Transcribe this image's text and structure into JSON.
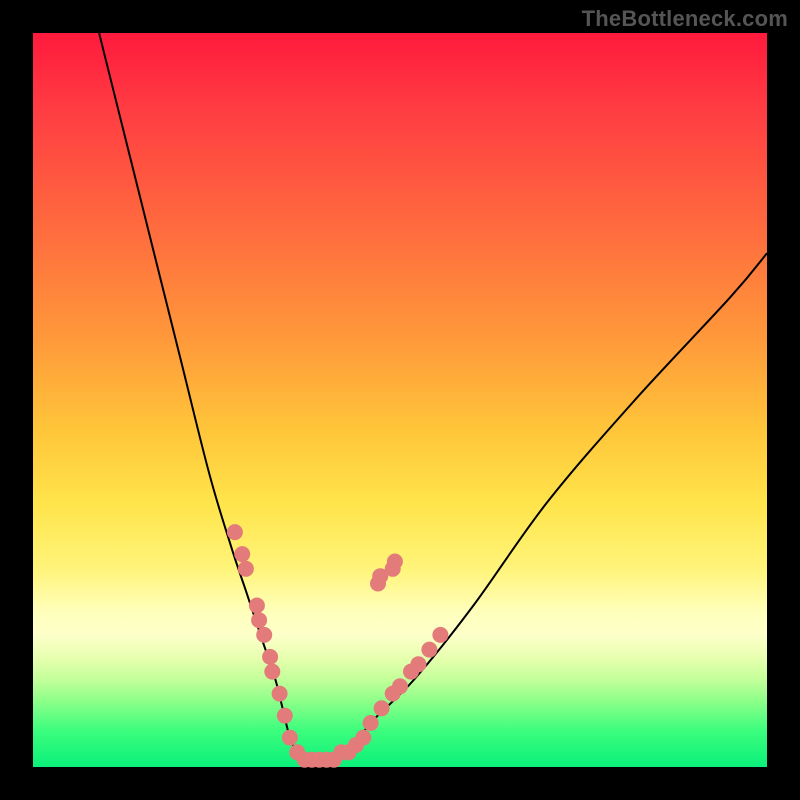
{
  "watermark": "TheBottleneck.com",
  "colors": {
    "background": "#000000",
    "curve": "#000000",
    "marker": "#e47b7b",
    "gradient_top": "#ff1a3d",
    "gradient_bottom": "#0af07a"
  },
  "chart_data": {
    "type": "line",
    "title": "",
    "xlabel": "",
    "ylabel": "",
    "xlim": [
      0,
      100
    ],
    "ylim": [
      0,
      100
    ],
    "series": [
      {
        "name": "bottleneck-curve",
        "x": [
          9,
          12,
          16,
          20,
          24,
          27,
          29,
          31,
          33,
          34,
          35,
          36,
          37,
          38,
          40,
          43,
          46,
          52,
          60,
          70,
          82,
          95,
          100
        ],
        "y": [
          100,
          88,
          72,
          56,
          40,
          30,
          24,
          18,
          12,
          8,
          4,
          2,
          1,
          1,
          1,
          2,
          6,
          12,
          22,
          36,
          50,
          64,
          70
        ]
      }
    ],
    "markers": [
      {
        "x": 27.5,
        "y": 32
      },
      {
        "x": 28.5,
        "y": 29
      },
      {
        "x": 29.0,
        "y": 27
      },
      {
        "x": 30.5,
        "y": 22
      },
      {
        "x": 30.8,
        "y": 20
      },
      {
        "x": 31.5,
        "y": 18
      },
      {
        "x": 32.3,
        "y": 15
      },
      {
        "x": 32.6,
        "y": 13
      },
      {
        "x": 33.6,
        "y": 10
      },
      {
        "x": 34.3,
        "y": 7
      },
      {
        "x": 35.0,
        "y": 4
      },
      {
        "x": 36.0,
        "y": 2
      },
      {
        "x": 37.0,
        "y": 1
      },
      {
        "x": 38.0,
        "y": 1
      },
      {
        "x": 39.0,
        "y": 1
      },
      {
        "x": 40.0,
        "y": 1
      },
      {
        "x": 41.0,
        "y": 1
      },
      {
        "x": 42.0,
        "y": 2
      },
      {
        "x": 43.0,
        "y": 2
      },
      {
        "x": 44.0,
        "y": 3
      },
      {
        "x": 45.0,
        "y": 4
      },
      {
        "x": 46.0,
        "y": 6
      },
      {
        "x": 47.5,
        "y": 8
      },
      {
        "x": 49.0,
        "y": 10
      },
      {
        "x": 50.0,
        "y": 11
      },
      {
        "x": 51.5,
        "y": 13
      },
      {
        "x": 52.5,
        "y": 14
      },
      {
        "x": 54.0,
        "y": 16
      },
      {
        "x": 55.5,
        "y": 18
      },
      {
        "x": 47.0,
        "y": 25
      },
      {
        "x": 47.3,
        "y": 26
      },
      {
        "x": 49.0,
        "y": 27
      },
      {
        "x": 49.3,
        "y": 28
      }
    ]
  }
}
